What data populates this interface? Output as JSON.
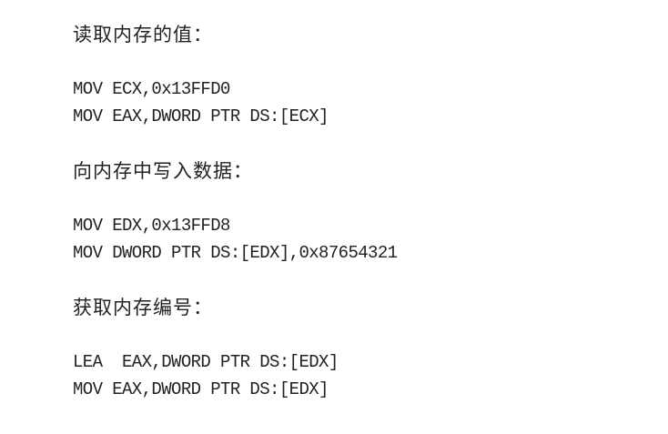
{
  "sections": [
    {
      "heading": "读取内存的值：",
      "code": [
        "MOV ECX,0x13FFD0",
        "MOV EAX,DWORD PTR DS:[ECX]"
      ]
    },
    {
      "heading": "向内存中写入数据：",
      "code": [
        "MOV EDX,0x13FFD8",
        "MOV DWORD PTR DS:[EDX],0x87654321"
      ]
    },
    {
      "heading": "获取内存编号：",
      "code": [
        "LEA  EAX,DWORD PTR DS:[EDX]",
        "MOV EAX,DWORD PTR DS:[EDX]"
      ]
    }
  ]
}
